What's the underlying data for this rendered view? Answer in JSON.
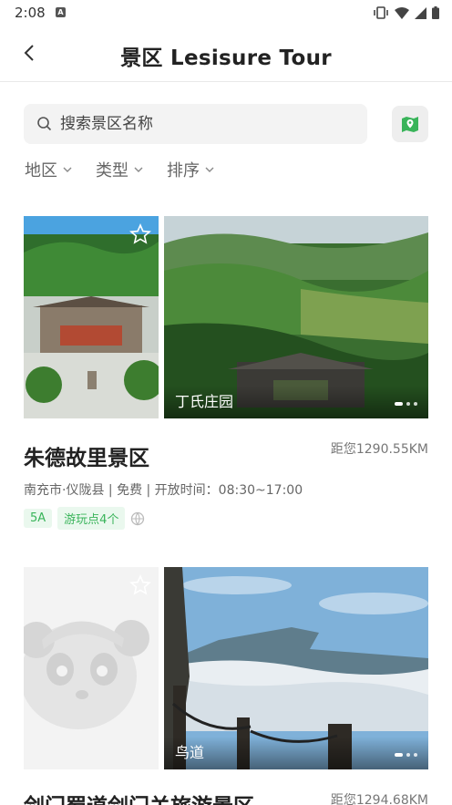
{
  "status_bar": {
    "time": "2:08",
    "notif_letter": "A"
  },
  "header": {
    "title": "景区 Lesisure Tour"
  },
  "search": {
    "placeholder": "搜索景区名称"
  },
  "filters": [
    {
      "label": "地区"
    },
    {
      "label": "类型"
    },
    {
      "label": "排序"
    }
  ],
  "cards": [
    {
      "name": "朱德故里景区",
      "distance": "距您1290.55KM",
      "meta": "南充市·仪陇县 | 免费 | 开放时间：08:30~17:00",
      "tags": [
        "5A",
        "游玩点4个"
      ],
      "image_caption": "丁氏庄园"
    },
    {
      "name": "剑门蜀道剑门关旅游景区",
      "distance": "距您1294.68KM",
      "image_caption": "鸟道"
    }
  ],
  "colors": {
    "accent_green": "#39b45a",
    "tag_bg": "#eaf8ee"
  }
}
